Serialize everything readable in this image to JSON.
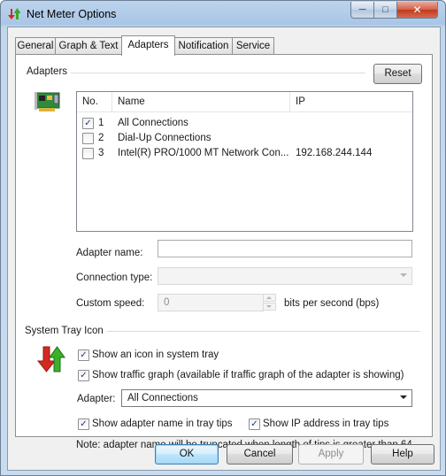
{
  "window": {
    "title": "Net Meter Options",
    "icon": "updown-arrows-icon",
    "controls": {
      "minimize": "minimize-icon",
      "maximize": "maximize-icon",
      "close": "close-icon"
    }
  },
  "tabs": [
    {
      "label": "General",
      "active": false
    },
    {
      "label": "Graph & Text",
      "active": false
    },
    {
      "label": "Adapters",
      "active": true
    },
    {
      "label": "Notification",
      "active": false
    },
    {
      "label": "Service",
      "active": false
    }
  ],
  "adapters": {
    "section_title": "Adapters",
    "reset_label": "Reset",
    "icon": "network-card-icon",
    "columns": [
      "No.",
      "Name",
      "IP"
    ],
    "rows": [
      {
        "checked": true,
        "no": "1",
        "name": "All Connections",
        "ip": ""
      },
      {
        "checked": false,
        "no": "2",
        "name": "Dial-Up Connections",
        "ip": ""
      },
      {
        "checked": false,
        "no": "3",
        "name": "Intel(R) PRO/1000 MT Network Con...",
        "ip": "192.168.244.144"
      }
    ],
    "adapter_name_label": "Adapter name:",
    "adapter_name_value": "",
    "connection_type_label": "Connection type:",
    "connection_type_value": "",
    "custom_speed_label": "Custom speed:",
    "custom_speed_value": "0",
    "speed_unit": "bits per second (bps)"
  },
  "tray": {
    "section_title": "System Tray Icon",
    "icon": "updown-arrows-icon",
    "show_icon_label": "Show an icon in system tray",
    "show_icon_checked": true,
    "show_graph_label": "Show traffic graph (available if traffic graph of the adapter is showing)",
    "show_graph_checked": true,
    "adapter_label": "Adapter:",
    "adapter_value": "All Connections",
    "show_name_label": "Show adapter name in tray tips",
    "show_name_checked": true,
    "show_ip_label": "Show IP address in tray tips",
    "show_ip_checked": true,
    "note": "Note: adapter name will be truncated when length of tips is greater than 64."
  },
  "buttons": {
    "ok": "OK",
    "cancel": "Cancel",
    "apply": "Apply",
    "help": "Help"
  }
}
